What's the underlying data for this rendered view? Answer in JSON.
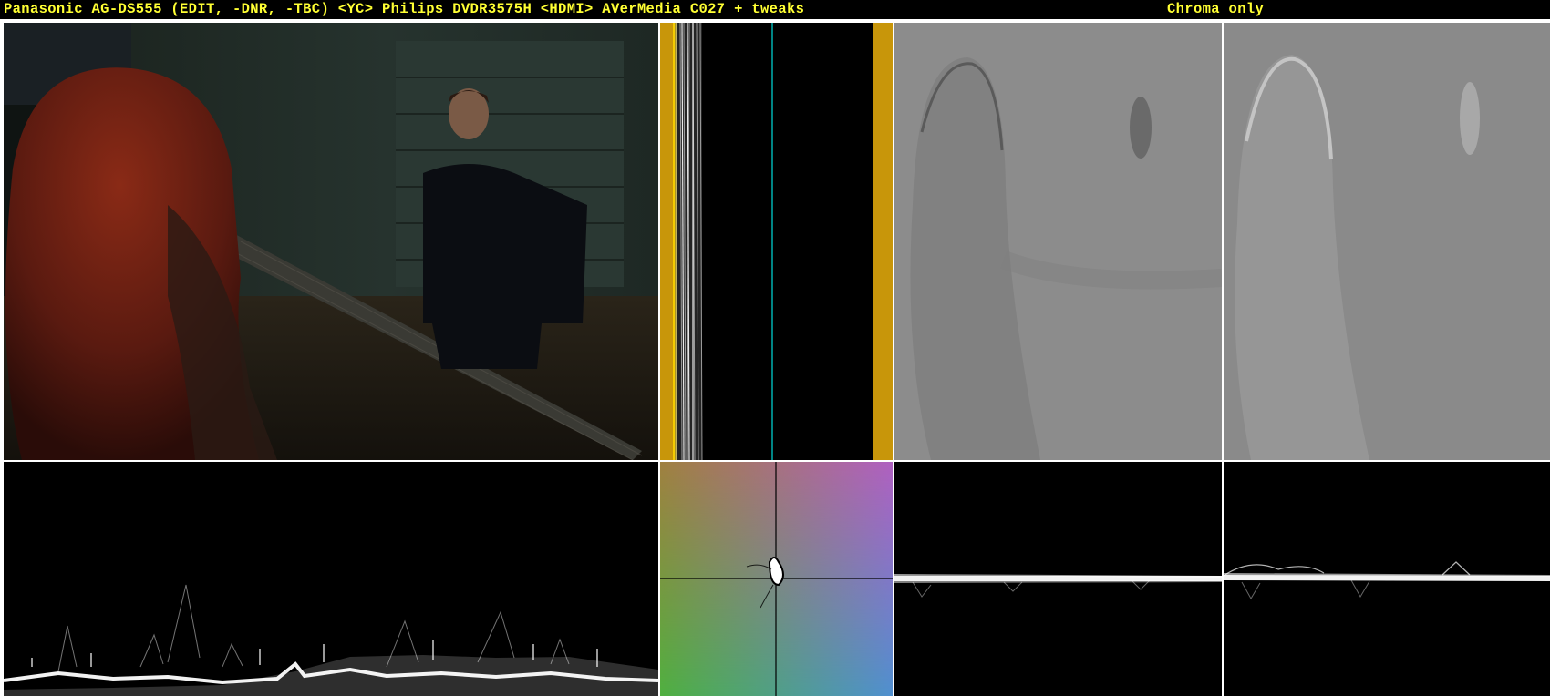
{
  "title": {
    "left": "Panasonic AG-DS555 (EDIT, -DNR, -TBC) <YC> Philips DVDR3575H <HDMI> AVerMedia C027 + tweaks",
    "right": "Chroma only"
  },
  "colors": {
    "title_text": "#ffff33",
    "background": "#000000",
    "divider": "#ffffff",
    "waveform_trace": "#ffffff",
    "vector_bar_gold": "#c8960a",
    "vector_center_line": "#00b0b0"
  },
  "panels": {
    "source_frame": "video-frame",
    "vectorscope_strip": "vertical-vectorscope",
    "chroma_u": "chroma-u-image",
    "chroma_v": "chroma-v-image",
    "luma_waveform": "luma-waveform",
    "vectorscope": "vectorscope",
    "chroma_u_waveform": "chroma-u-waveform",
    "chroma_v_waveform": "chroma-v-waveform"
  }
}
